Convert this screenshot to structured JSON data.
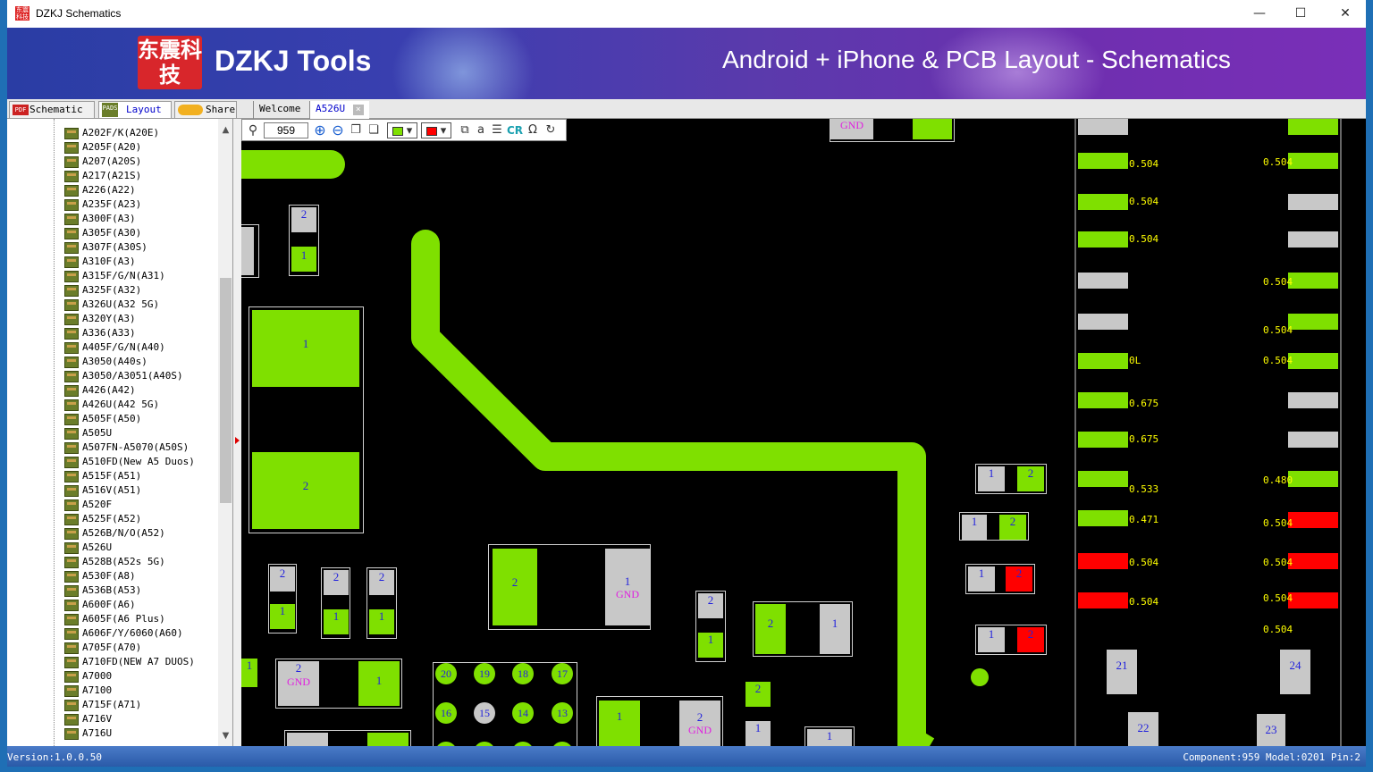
{
  "window": {
    "title": "DZKJ Schematics",
    "app_icon": "东震科技",
    "minimize": "—",
    "maximize": "☐",
    "close": "✕"
  },
  "banner": {
    "logo_text": "东震科技",
    "brand": "DZKJ Tools",
    "tagline": "Android + iPhone & PCB Layout - Schematics"
  },
  "tabs": {
    "schematic": "Schematic",
    "layout": "Layout",
    "share": "Share",
    "schematic_icon": "PDF",
    "layout_icon": "PADS"
  },
  "doc_tabs": {
    "welcome": "Welcome",
    "current": "A526U",
    "close": "×"
  },
  "tree": [
    "A202F/K(A20E)",
    "A205F(A20)",
    "A207(A20S)",
    "A217(A21S)",
    "A226(A22)",
    "A235F(A23)",
    "A300F(A3)",
    "A305F(A30)",
    "A307F(A30S)",
    "A310F(A3)",
    "A315F/G/N(A31)",
    "A325F(A32)",
    "A326U(A32 5G)",
    "A320Y(A3)",
    "A336(A33)",
    "A405F/G/N(A40)",
    "A3050(A40s)",
    "A3050/A3051(A40S)",
    "A426(A42)",
    "A426U(A42 5G)",
    "A505F(A50)",
    "A505U",
    "A507FN-A5070(A50S)",
    "A510FD(New A5 Duos)",
    "A515F(A51)",
    "A516V(A51)",
    "A520F",
    "A525F(A52)",
    "A526B/N/O(A52)",
    "A526U",
    "A528B(A52s 5G)",
    "A530F(A8)",
    "A536B(A53)",
    "A600F(A6)",
    "A605F(A6 Plus)",
    "A606F/Y/6060(A60)",
    "A705F(A70)",
    "A710FD(NEW A7 DUOS)",
    "A7000",
    "A7100",
    "A715F(A71)",
    "A716V",
    "A716U"
  ],
  "toolbar": {
    "zoom_value": "959",
    "cr_label": "CR"
  },
  "pcb": {
    "gnd": "GND",
    "values_left": [
      "0.504",
      "0.504",
      "0.504",
      "0L",
      "0.675",
      "0.675",
      "0.533",
      "0.471",
      "0.504",
      "0.504"
    ],
    "values_right": [
      "0.504",
      "0.504",
      "0.504",
      "0.504",
      "0.504",
      "0.480",
      "0.504",
      "0.504",
      "0.504",
      "0.504"
    ],
    "bga": [
      "20",
      "19",
      "18",
      "17",
      "16",
      "15",
      "14",
      "13"
    ],
    "pins": {
      "p1": "1",
      "p2": "2",
      "p21": "21",
      "p22": "22",
      "p23": "23",
      "p24": "24"
    }
  },
  "status": {
    "version": "Version:1.0.0.50",
    "info": "Component:959 Model:0201 Pin:2"
  }
}
